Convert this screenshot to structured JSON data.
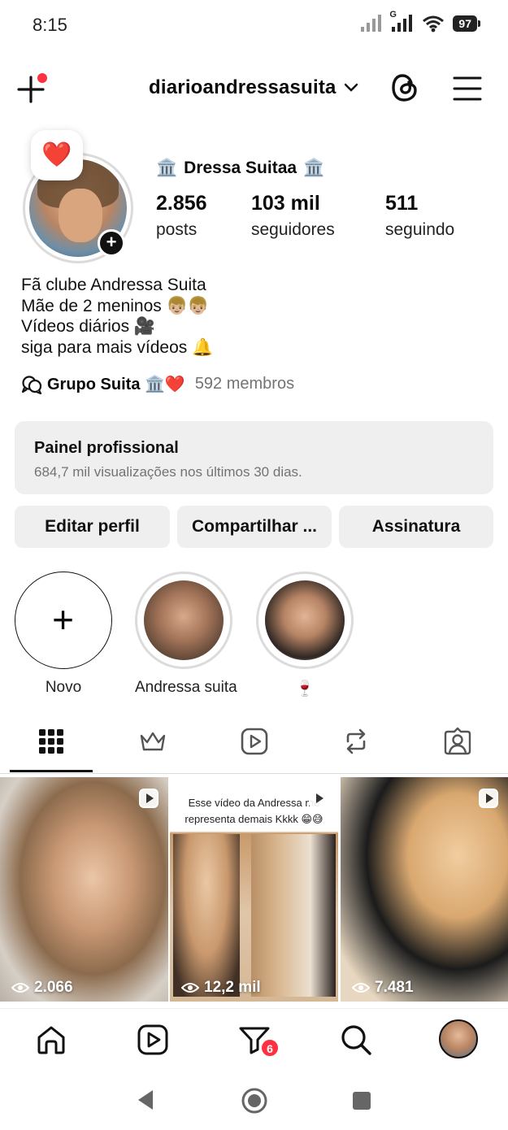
{
  "status_bar": {
    "time": "8:15",
    "network_label": "G",
    "battery": "97"
  },
  "header": {
    "username": "diarioandressasuita",
    "notification_dot_color": "#ff3040"
  },
  "profile": {
    "note_emoji": "❤️",
    "display_name": "Dressa Suitaa",
    "name_emoji": "🏛️",
    "stats": [
      {
        "value": "2.856",
        "label": "posts"
      },
      {
        "value": "103 mil",
        "label": "seguidores"
      },
      {
        "value": "511",
        "label": "seguindo"
      }
    ],
    "bio_lines": [
      "Fã clube Andressa Suita",
      "Mãe de 2 meninos 👦🏼👦🏼",
      "Vídeos diários 🎥",
      "siga para mais vídeos 🔔"
    ],
    "group": {
      "name": "Grupo Suita 🏛️❤️",
      "members": "592 membros"
    }
  },
  "dashboard": {
    "title": "Painel profissional",
    "subtitle": "684,7 mil visualizações nos últimos 30 dias."
  },
  "actions": {
    "edit": "Editar perfil",
    "share": "Compartilhar ...",
    "subscription": "Assinatura"
  },
  "highlights": [
    {
      "label": "Novo",
      "icon": "plus-icon"
    },
    {
      "label": "Andressa suita"
    },
    {
      "label": "🍷"
    }
  ],
  "tabs": [
    "grid-icon",
    "crown-icon",
    "reels-icon",
    "repost-icon",
    "tagged-icon"
  ],
  "grid": [
    {
      "views": "2.066",
      "caption": ""
    },
    {
      "views": "12,2 mil",
      "caption": "Esse vídeo da Andressa me representa demais Kkkk 😁😅"
    },
    {
      "views": "7.481",
      "caption": ""
    }
  ],
  "bottom_nav": {
    "activity_badge": "6"
  },
  "colors": {
    "accent": "#ff3040",
    "panel_bg": "#efefef",
    "muted_text": "#737373"
  }
}
